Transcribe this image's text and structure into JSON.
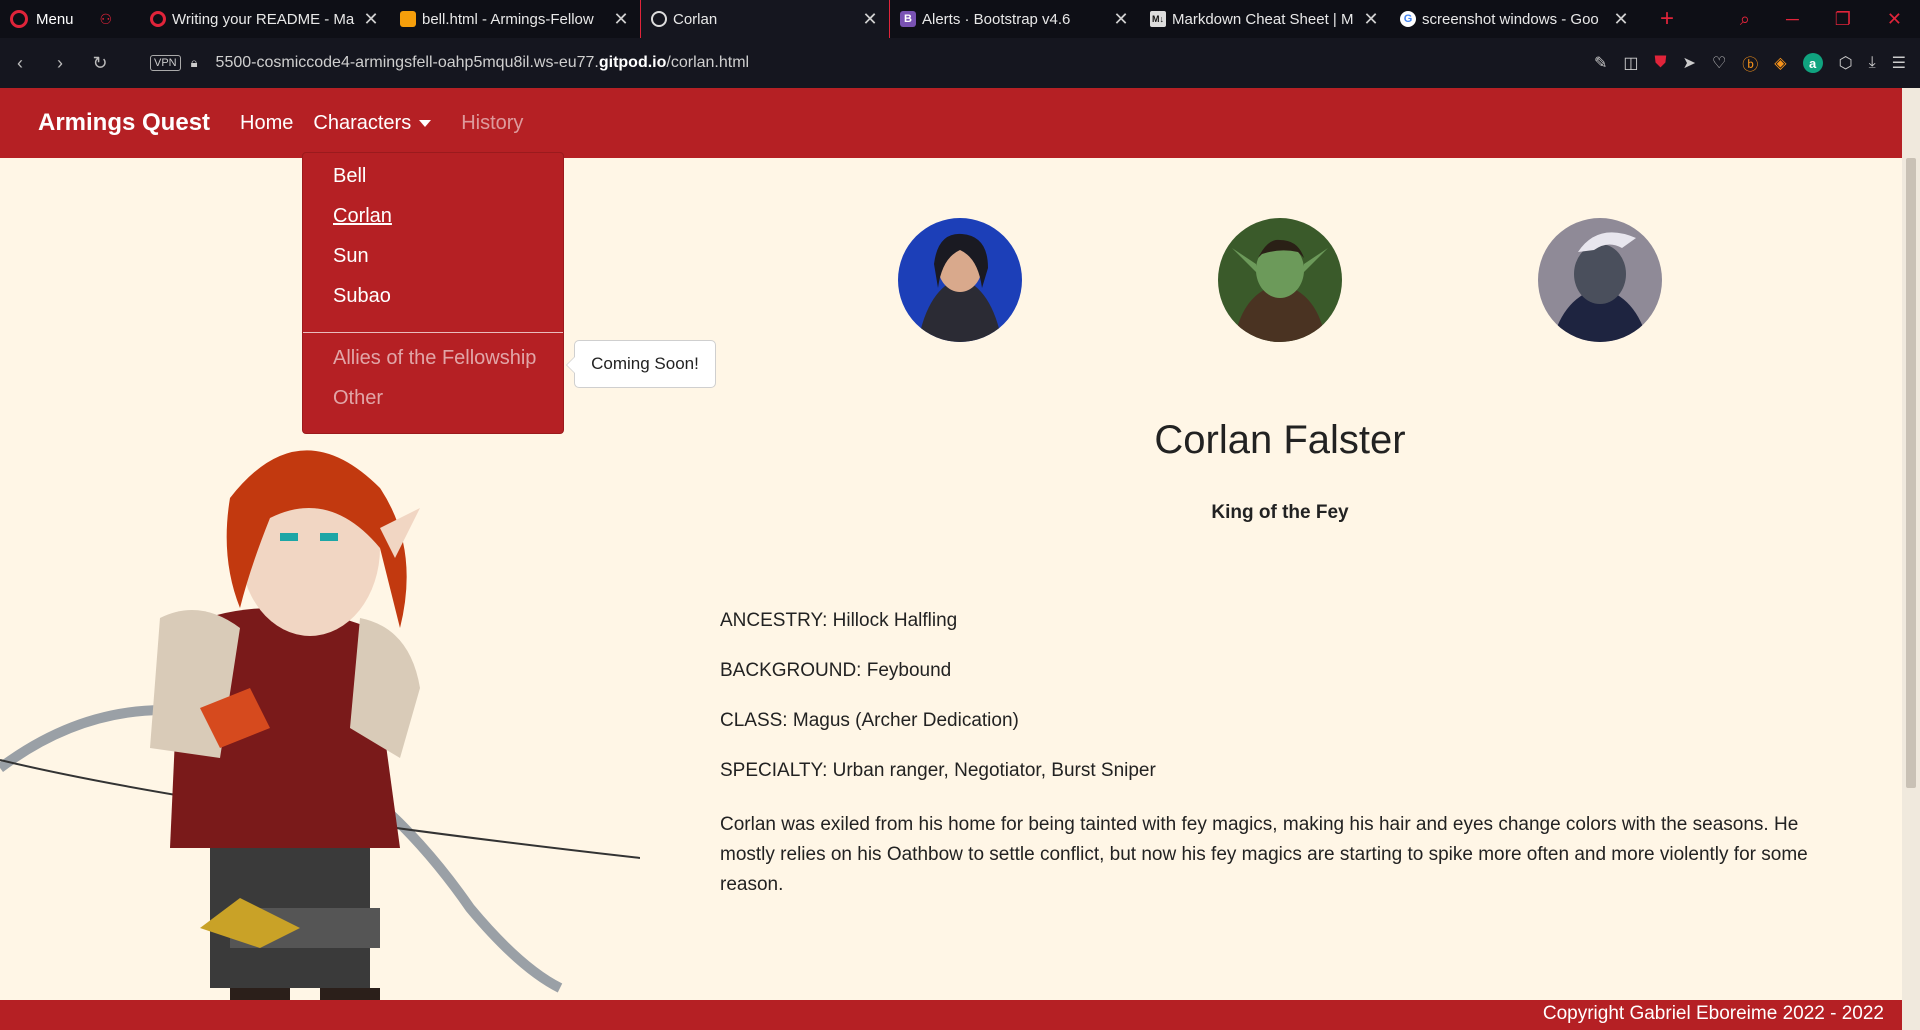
{
  "browser": {
    "menu_label": "Menu",
    "tabs": [
      {
        "title": "Writing your README - Ma",
        "icon": "opera-icon"
      },
      {
        "title": "bell.html - Armings-Fellow",
        "icon": "gitpod-icon"
      },
      {
        "title": "Corlan",
        "icon": "globe-icon",
        "active": true
      },
      {
        "title": "Alerts · Bootstrap v4.6",
        "icon": "bootstrap-icon"
      },
      {
        "title": "Markdown Cheat Sheet | M",
        "icon": "markdown-icon"
      },
      {
        "title": "screenshot windows - Goo",
        "icon": "google-icon"
      }
    ],
    "tab_close_glyph": "✕",
    "vpn_label": "VPN",
    "url_prefix": "5500-cosmiccode4-armingsfell-oahp5mqu8il.ws-eu77.",
    "url_domain": "gitpod.io",
    "url_path": "/corlan.html"
  },
  "site": {
    "brand": "Armings Quest",
    "nav": {
      "home": "Home",
      "characters": "Characters",
      "history": "History"
    },
    "dropdown": {
      "items": [
        "Bell",
        "Corlan",
        "Sun",
        "Subao"
      ],
      "current": "Corlan",
      "disabled_items": [
        "Allies of the Fellowship",
        "Other"
      ]
    },
    "tooltip": "Coming Soon!",
    "character": {
      "name": "Corlan Falster",
      "title": "King of the Fey",
      "stats": [
        "ANCESTRY: Hillock Halfling",
        "BACKGROUND: Feybound",
        "CLASS: Magus (Archer Dedication)",
        "SPECIALTY: Urban ranger, Negotiator, Burst Sniper"
      ],
      "bio": "Corlan was exiled from his home for being tainted with fey magics, making his hair and eyes change colors with the seasons. He mostly relies on his Oathbow to settle conflict, but now his fey magics are starting to spike more often and more violently for some reason."
    },
    "footer": "Copyright Gabriel Eboreime 2022 - 2022"
  },
  "colors": {
    "brand_red": "#b52024",
    "page_background": "#fff6e6",
    "browser_dark": "#0e0f16",
    "opera_red": "#e0243a"
  }
}
